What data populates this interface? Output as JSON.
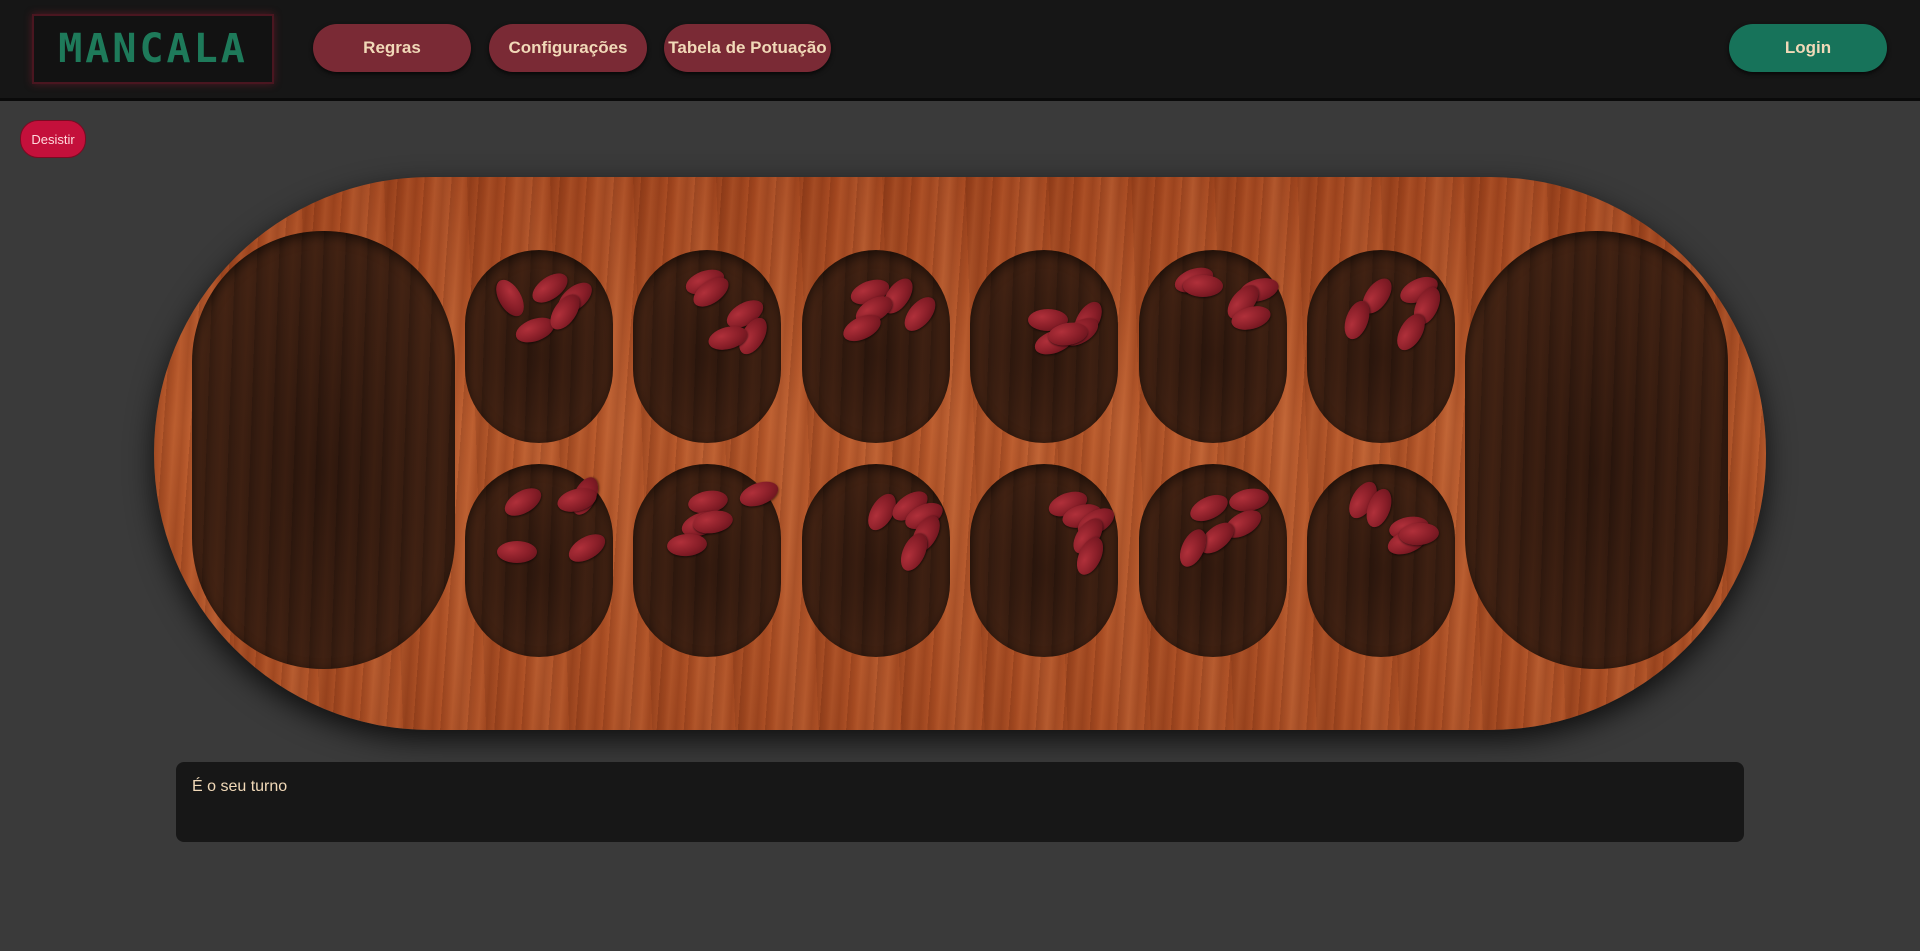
{
  "header": {
    "logo_text": "MANCALA",
    "nav": {
      "rules_label": "Regras",
      "settings_label": "Configurações",
      "scoreboard_label": "Tabela de Potuação"
    },
    "login_label": "Login"
  },
  "game": {
    "give_up_label": "Desistir",
    "status_message": "É o seu turno",
    "colors": {
      "board_wood": "#b0522a",
      "pit": "#3a1e10",
      "seed": "#8b1e28",
      "nav_button": "#7a2a35",
      "login_button": "#17735a",
      "give_up_button": "#c4103b"
    },
    "board": {
      "stores": {
        "left": 0,
        "right": 0
      },
      "top_row": [
        {
          "seeds": 5
        },
        {
          "seeds": 5
        },
        {
          "seeds": 5
        },
        {
          "seeds": 5
        },
        {
          "seeds": 5
        },
        {
          "seeds": 5
        }
      ],
      "bottom_row": [
        {
          "seeds": 5
        },
        {
          "seeds": 5
        },
        {
          "seeds": 5
        },
        {
          "seeds": 5
        },
        {
          "seeds": 5
        },
        {
          "seeds": 5
        }
      ]
    }
  }
}
